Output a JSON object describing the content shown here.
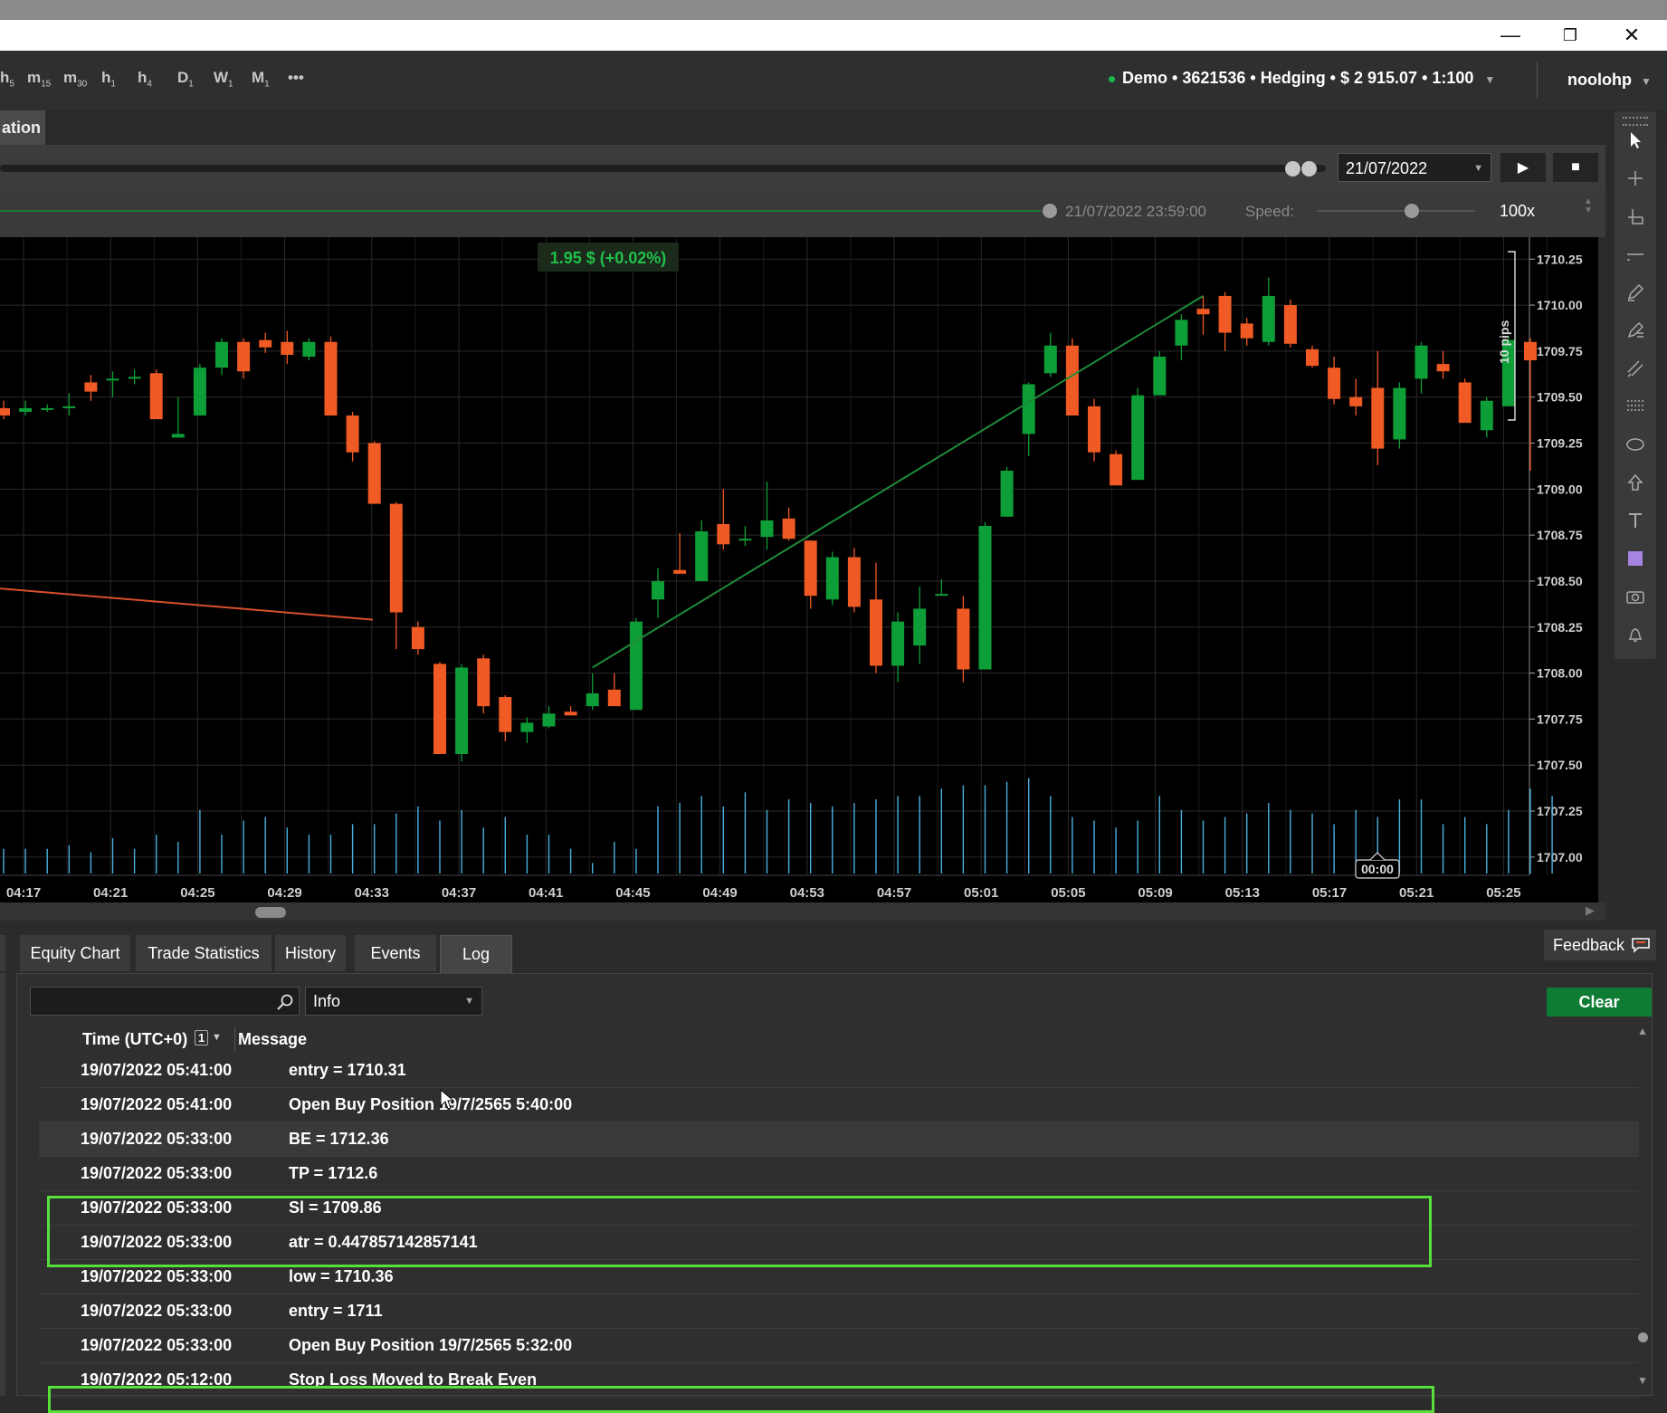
{
  "window": {
    "minimize": "—",
    "restore": "❐",
    "close": "✕"
  },
  "timeframes": [
    {
      "main": "h",
      "sub": "5"
    },
    {
      "main": "m",
      "sub": "15"
    },
    {
      "main": "m",
      "sub": "30"
    },
    {
      "main": "h",
      "sub": "1"
    },
    {
      "main": "h",
      "sub": "4"
    },
    {
      "main": "D",
      "sub": "1"
    },
    {
      "main": "W",
      "sub": "1"
    },
    {
      "main": "M",
      "sub": "1"
    },
    {
      "main": "•••",
      "sub": ""
    }
  ],
  "account": {
    "text": "Demo • 3621536 • Hedging • $ 2 915.07 • 1:100",
    "user": "noolohp",
    "status_color": "#18b84a"
  },
  "tabs": {
    "automation": "ation"
  },
  "backtest": {
    "date": "21/07/2022",
    "end_time": "21/07/2022 23:59:00",
    "speed_label": "Speed:",
    "speed_value": "100x",
    "speed_fraction": 0.6
  },
  "chart_data": {
    "type": "candlestick",
    "pnl_label": "1.95 $ (+0.02%)",
    "pips_label": "10 pips",
    "cursor_time": "00:00",
    "y_ticks": [
      "1710.25",
      "1710.00",
      "1709.75",
      "1709.50",
      "1709.25",
      "1709.00",
      "1708.75",
      "1708.50",
      "1708.25",
      "1708.00",
      "1707.75",
      "1707.50",
      "1707.25",
      "1707.00"
    ],
    "x_ticks": [
      "04:17",
      "04:21",
      "04:25",
      "04:29",
      "04:33",
      "04:37",
      "04:41",
      "04:45",
      "04:49",
      "04:53",
      "04:57",
      "05:01",
      "05:05",
      "05:09",
      "05:13",
      "05:17",
      "05:21",
      "05:25"
    ],
    "ylim": [
      1706.95,
      1710.33
    ],
    "colors": {
      "up": "#0e9e38",
      "down": "#f05a24",
      "volume": "#4ab0e0",
      "trend": "#1f8a3a",
      "entry": "#d8502a"
    },
    "candles": [
      {
        "o": 1709.44,
        "h": 1709.48,
        "l": 1709.38,
        "c": 1709.4
      },
      {
        "o": 1709.42,
        "h": 1709.48,
        "l": 1709.4,
        "c": 1709.44
      },
      {
        "o": 1709.44,
        "h": 1709.46,
        "l": 1709.42,
        "c": 1709.44
      },
      {
        "o": 1709.44,
        "h": 1709.52,
        "l": 1709.4,
        "c": 1709.45
      },
      {
        "o": 1709.58,
        "h": 1709.62,
        "l": 1709.48,
        "c": 1709.53
      },
      {
        "o": 1709.6,
        "h": 1709.64,
        "l": 1709.5,
        "c": 1709.6
      },
      {
        "o": 1709.61,
        "h": 1709.65,
        "l": 1709.57,
        "c": 1709.61
      },
      {
        "o": 1709.63,
        "h": 1709.65,
        "l": 1709.4,
        "c": 1709.38
      },
      {
        "o": 1709.28,
        "h": 1709.5,
        "l": 1709.28,
        "c": 1709.3
      },
      {
        "o": 1709.4,
        "h": 1709.68,
        "l": 1709.4,
        "c": 1709.66
      },
      {
        "o": 1709.66,
        "h": 1709.82,
        "l": 1709.62,
        "c": 1709.8
      },
      {
        "o": 1709.8,
        "h": 1709.82,
        "l": 1709.6,
        "c": 1709.64
      },
      {
        "o": 1709.81,
        "h": 1709.85,
        "l": 1709.74,
        "c": 1709.77
      },
      {
        "o": 1709.8,
        "h": 1709.86,
        "l": 1709.68,
        "c": 1709.73
      },
      {
        "o": 1709.72,
        "h": 1709.82,
        "l": 1709.7,
        "c": 1709.8
      },
      {
        "o": 1709.8,
        "h": 1709.83,
        "l": 1709.4,
        "c": 1709.4
      },
      {
        "o": 1709.4,
        "h": 1709.42,
        "l": 1709.15,
        "c": 1709.2
      },
      {
        "o": 1709.25,
        "h": 1709.26,
        "l": 1708.92,
        "c": 1708.92
      },
      {
        "o": 1708.92,
        "h": 1708.93,
        "l": 1708.13,
        "c": 1708.33
      },
      {
        "o": 1708.25,
        "h": 1708.28,
        "l": 1708.1,
        "c": 1708.13
      },
      {
        "o": 1708.05,
        "h": 1708.06,
        "l": 1707.56,
        "c": 1707.56
      },
      {
        "o": 1707.56,
        "h": 1708.05,
        "l": 1707.52,
        "c": 1708.03
      },
      {
        "o": 1708.08,
        "h": 1708.1,
        "l": 1707.78,
        "c": 1707.82
      },
      {
        "o": 1707.87,
        "h": 1707.88,
        "l": 1707.63,
        "c": 1707.68
      },
      {
        "o": 1707.68,
        "h": 1707.76,
        "l": 1707.62,
        "c": 1707.73
      },
      {
        "o": 1707.71,
        "h": 1707.82,
        "l": 1707.7,
        "c": 1707.78
      },
      {
        "o": 1707.79,
        "h": 1707.82,
        "l": 1707.77,
        "c": 1707.77
      },
      {
        "o": 1707.82,
        "h": 1708.0,
        "l": 1707.8,
        "c": 1707.89
      },
      {
        "o": 1707.91,
        "h": 1708.0,
        "l": 1707.86,
        "c": 1707.82
      },
      {
        "o": 1707.8,
        "h": 1708.3,
        "l": 1707.8,
        "c": 1708.28
      },
      {
        "o": 1708.4,
        "h": 1708.57,
        "l": 1708.3,
        "c": 1708.5
      },
      {
        "o": 1708.56,
        "h": 1708.76,
        "l": 1708.54,
        "c": 1708.54
      },
      {
        "o": 1708.5,
        "h": 1708.83,
        "l": 1708.5,
        "c": 1708.77
      },
      {
        "o": 1708.81,
        "h": 1709.0,
        "l": 1708.67,
        "c": 1708.7
      },
      {
        "o": 1708.73,
        "h": 1708.8,
        "l": 1708.69,
        "c": 1708.73
      },
      {
        "o": 1708.74,
        "h": 1709.04,
        "l": 1708.67,
        "c": 1708.83
      },
      {
        "o": 1708.84,
        "h": 1708.9,
        "l": 1708.72,
        "c": 1708.73
      },
      {
        "o": 1708.72,
        "h": 1708.72,
        "l": 1708.35,
        "c": 1708.42
      },
      {
        "o": 1708.4,
        "h": 1708.66,
        "l": 1708.37,
        "c": 1708.63
      },
      {
        "o": 1708.63,
        "h": 1708.68,
        "l": 1708.33,
        "c": 1708.36
      },
      {
        "o": 1708.4,
        "h": 1708.6,
        "l": 1708.0,
        "c": 1708.04
      },
      {
        "o": 1708.04,
        "h": 1708.33,
        "l": 1707.95,
        "c": 1708.28
      },
      {
        "o": 1708.15,
        "h": 1708.47,
        "l": 1708.05,
        "c": 1708.35
      },
      {
        "o": 1708.43,
        "h": 1708.51,
        "l": 1708.43,
        "c": 1708.43
      },
      {
        "o": 1708.35,
        "h": 1708.42,
        "l": 1707.95,
        "c": 1708.02
      },
      {
        "o": 1708.02,
        "h": 1708.82,
        "l": 1708.02,
        "c": 1708.8
      },
      {
        "o": 1708.85,
        "h": 1709.12,
        "l": 1708.85,
        "c": 1709.1
      },
      {
        "o": 1709.3,
        "h": 1709.58,
        "l": 1709.18,
        "c": 1709.57
      },
      {
        "o": 1709.63,
        "h": 1709.85,
        "l": 1709.61,
        "c": 1709.78
      },
      {
        "o": 1709.78,
        "h": 1709.82,
        "l": 1709.5,
        "c": 1709.4
      },
      {
        "o": 1709.45,
        "h": 1709.49,
        "l": 1709.15,
        "c": 1709.2
      },
      {
        "o": 1709.19,
        "h": 1709.21,
        "l": 1709.05,
        "c": 1709.02
      },
      {
        "o": 1709.05,
        "h": 1709.55,
        "l": 1709.05,
        "c": 1709.51
      },
      {
        "o": 1709.51,
        "h": 1709.75,
        "l": 1709.51,
        "c": 1709.72
      },
      {
        "o": 1709.78,
        "h": 1709.95,
        "l": 1709.7,
        "c": 1709.92
      },
      {
        "o": 1709.98,
        "h": 1710.05,
        "l": 1709.84,
        "c": 1709.95
      },
      {
        "o": 1710.05,
        "h": 1710.07,
        "l": 1709.75,
        "c": 1709.85
      },
      {
        "o": 1709.9,
        "h": 1709.93,
        "l": 1709.78,
        "c": 1709.82
      },
      {
        "o": 1709.8,
        "h": 1710.15,
        "l": 1709.78,
        "c": 1710.05
      },
      {
        "o": 1710.0,
        "h": 1710.03,
        "l": 1709.77,
        "c": 1709.79
      },
      {
        "o": 1709.76,
        "h": 1709.78,
        "l": 1709.66,
        "c": 1709.67
      },
      {
        "o": 1709.66,
        "h": 1709.72,
        "l": 1709.46,
        "c": 1709.49
      },
      {
        "o": 1709.5,
        "h": 1709.6,
        "l": 1709.4,
        "c": 1709.45
      },
      {
        "o": 1709.55,
        "h": 1709.75,
        "l": 1709.13,
        "c": 1709.22
      },
      {
        "o": 1709.27,
        "h": 1709.58,
        "l": 1709.22,
        "c": 1709.55
      },
      {
        "o": 1709.6,
        "h": 1709.8,
        "l": 1709.52,
        "c": 1709.78
      },
      {
        "o": 1709.68,
        "h": 1709.75,
        "l": 1709.6,
        "c": 1709.64
      },
      {
        "o": 1709.58,
        "h": 1709.6,
        "l": 1709.38,
        "c": 1709.36
      },
      {
        "o": 1709.32,
        "h": 1709.5,
        "l": 1709.28,
        "c": 1709.48
      },
      {
        "o": 1709.45,
        "h": 1709.83,
        "l": 1709.45,
        "c": 1709.81
      },
      {
        "o": 1709.8,
        "h": 1709.82,
        "l": 1709.1,
        "c": 1709.7
      }
    ],
    "volumes": [
      0.35,
      0.35,
      0.35,
      0.4,
      0.3,
      0.5,
      0.35,
      0.55,
      0.45,
      0.9,
      0.55,
      0.75,
      0.8,
      0.65,
      0.55,
      0.55,
      0.7,
      0.7,
      0.85,
      0.95,
      0.75,
      0.9,
      0.65,
      0.8,
      0.55,
      0.55,
      0.35,
      0.15,
      0.45,
      0.35,
      0.95,
      1.0,
      1.1,
      0.95,
      1.15,
      0.9,
      1.05,
      1.0,
      0.95,
      1.0,
      1.05,
      1.1,
      1.1,
      1.2,
      1.25,
      1.25,
      1.3,
      1.35,
      1.1,
      0.8,
      0.75,
      0.65,
      0.75,
      1.1,
      0.9,
      0.75,
      0.8,
      0.85,
      1.0,
      0.9,
      0.85,
      0.7,
      0.9,
      0.8,
      1.05,
      1.05,
      0.7,
      0.8,
      0.7,
      0.9,
      1.2,
      1.1
    ]
  },
  "bottom": {
    "tabs": [
      "Equity Chart",
      "Trade Statistics",
      "History",
      "Events",
      "Log"
    ],
    "active_tab": "Log",
    "feedback": "Feedback",
    "search_placeholder": "",
    "level": "Info",
    "clear": "Clear",
    "columns": {
      "time": "Time (UTC+0)",
      "sort_badge": "1",
      "message": "Message"
    },
    "rows": [
      {
        "time": "19/07/2022 05:41:00",
        "message": "entry = 1710.31"
      },
      {
        "time": "19/07/2022 05:41:00",
        "message": "Open Buy Position 19/7/2565 5:40:00"
      },
      {
        "time": "19/07/2022 05:33:00",
        "message": "BE = 1712.36"
      },
      {
        "time": "19/07/2022 05:33:00",
        "message": "TP = 1712.6"
      },
      {
        "time": "19/07/2022 05:33:00",
        "message": "Sl = 1709.86"
      },
      {
        "time": "19/07/2022 05:33:00",
        "message": "atr = 0.447857142857141"
      },
      {
        "time": "19/07/2022 05:33:00",
        "message": "low = 1710.36"
      },
      {
        "time": "19/07/2022 05:33:00",
        "message": "entry = 1711"
      },
      {
        "time": "19/07/2022 05:33:00",
        "message": "Open Buy Position 19/7/2565 5:32:00"
      },
      {
        "time": "19/07/2022 05:12:00",
        "message": "Stop Loss Moved to Break Even"
      }
    ]
  }
}
